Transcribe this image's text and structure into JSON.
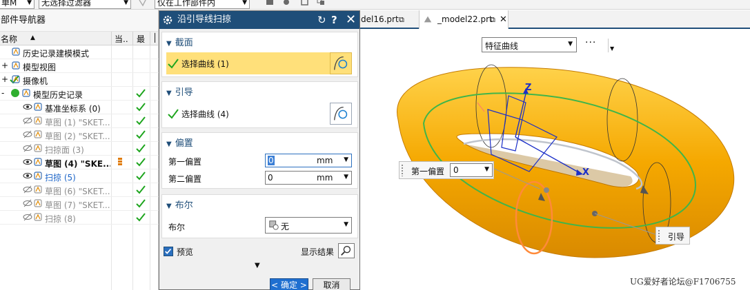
{
  "toolbar": {
    "menu_label": "单M",
    "filter_label": "无选择过滤器",
    "scope_label": "仅在工作部件内"
  },
  "navigator": {
    "title": "部件导航器",
    "columns": {
      "name": "名称",
      "current": "当..",
      "latest": "最",
      "extra": "│"
    },
    "rows": [
      {
        "indent": 0,
        "expander": "",
        "name": "历史记录建模模式",
        "style": "normal",
        "latest": false,
        "icon": "clock-icon"
      },
      {
        "indent": 0,
        "expander": "+",
        "name": "模型视图",
        "style": "normal",
        "latest": false,
        "icon": "model-view-icon"
      },
      {
        "indent": 0,
        "expander": "+",
        "name": "摄像机",
        "style": "normal",
        "latest": false,
        "icon": "camera-icon"
      },
      {
        "indent": 0,
        "expander": "-",
        "name": "模型历史记录",
        "style": "normal",
        "latest": true,
        "icon": "history-icon"
      },
      {
        "indent": 1,
        "expander": "",
        "name": "基准坐标系 (0)",
        "style": "normal",
        "latest": true,
        "icon": "datum-csys-icon"
      },
      {
        "indent": 1,
        "expander": "",
        "name": "草图 (1) \"SKET...",
        "style": "grey",
        "latest": true,
        "icon": "sketch-icon"
      },
      {
        "indent": 1,
        "expander": "",
        "name": "草图 (2) \"SKET...",
        "style": "grey",
        "latest": true,
        "icon": "sketch-icon"
      },
      {
        "indent": 1,
        "expander": "",
        "name": "扫掠面 (3)",
        "style": "grey",
        "latest": true,
        "icon": "sweep-face-icon"
      },
      {
        "indent": 1,
        "expander": "",
        "name": "草图 (4) \"SKE...",
        "style": "bold",
        "latest": true,
        "icon": "sketch-icon"
      },
      {
        "indent": 1,
        "expander": "",
        "name": "扫掠 (5)",
        "style": "blue",
        "latest": true,
        "icon": "sweep-icon"
      },
      {
        "indent": 1,
        "expander": "",
        "name": "草图 (6) \"SKET...",
        "style": "grey",
        "latest": true,
        "icon": "sketch-icon"
      },
      {
        "indent": 1,
        "expander": "",
        "name": "草图 (7) \"SKET...",
        "style": "grey",
        "latest": true,
        "icon": "sketch-icon"
      },
      {
        "indent": 1,
        "expander": "",
        "name": "扫掠 (8)",
        "style": "grey",
        "latest": true,
        "icon": "sweep-icon"
      }
    ]
  },
  "dialog": {
    "title": "沿引导线扫掠",
    "section_profile": {
      "header": "截面",
      "select_label": "选择曲线 (1)"
    },
    "section_guide": {
      "header": "引导",
      "select_label": "选择曲线 (4)"
    },
    "section_offset": {
      "header": "偏置",
      "first_label": "第一偏置",
      "first_value": "0",
      "first_unit": "mm",
      "second_label": "第二偏置",
      "second_value": "0",
      "second_unit": "mm"
    },
    "section_boolean": {
      "header": "布尔",
      "label": "布尔",
      "value": "无"
    },
    "preview_label": "预览",
    "show_result_label": "显示结果",
    "ok_label": "< 确定 >",
    "cancel_label": "取消"
  },
  "tabs": [
    {
      "label": "del16.prt",
      "active": false
    },
    {
      "label": "_model22.prt",
      "active": true
    }
  ],
  "viewport": {
    "filter_value": "特征曲线",
    "more_label": "···",
    "axis_z": "Z",
    "axis_x": "X",
    "offset_overlay_label": "第一偏置",
    "offset_overlay_value": "0",
    "guide_overlay_label": "引导",
    "watermark": "UG爱好者论坛@F1706755"
  },
  "colors": {
    "dialog_title_bg": "#1f4e79",
    "active_selection": "#ffe07a",
    "check_green": "#1ea51e",
    "solid_orange": "#f5a800",
    "guide_green": "#3fb54a"
  }
}
